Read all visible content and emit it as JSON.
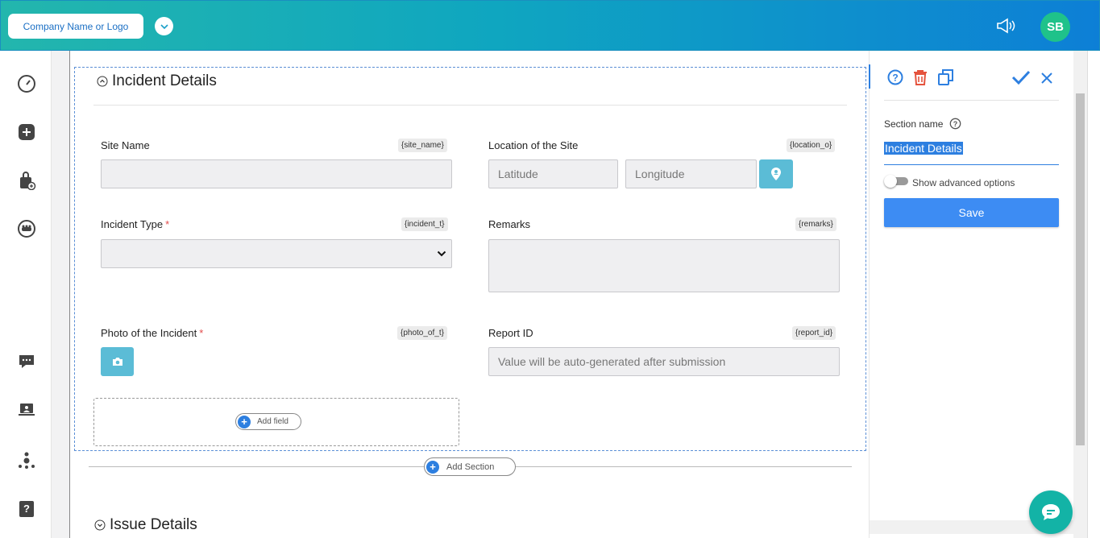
{
  "topbar": {
    "company_label": "Company Name or Logo",
    "avatar_initials": "SB"
  },
  "sidebar": {
    "icons": [
      "dashboard-gauge-icon",
      "add-square-icon",
      "bag-add-icon",
      "users-circle-icon",
      "chat-icon",
      "laptop-user-icon",
      "org-tree-icon",
      "help-book-icon"
    ]
  },
  "section": {
    "title": "Incident Details",
    "fields": {
      "site_name": {
        "label": "Site Name",
        "tag": "{site_name}",
        "value": ""
      },
      "location": {
        "label": "Location of the Site",
        "tag": "{location_o}",
        "lat_placeholder": "Latitude",
        "lng_placeholder": "Longitude"
      },
      "incident_type": {
        "label": "Incident Type",
        "required_mark": "*",
        "tag": "{incident_t}",
        "value": ""
      },
      "remarks": {
        "label": "Remarks",
        "tag": "{remarks}",
        "value": ""
      },
      "photo": {
        "label": "Photo of the Incident",
        "required_mark": "*",
        "tag": "{photo_of_t}"
      },
      "report_id": {
        "label": "Report ID",
        "tag": "{report_id}",
        "placeholder": "Value will be auto-generated after submission"
      }
    },
    "add_field_label": "Add field"
  },
  "add_section_label": "Add Section",
  "next_section": {
    "title": "Issue Details"
  },
  "right_panel": {
    "section_name_label": "Section name",
    "section_name_value": "Incident Details",
    "advanced_toggle_label": "Show advanced options",
    "advanced_toggle_on": false,
    "save_label": "Save"
  },
  "colors": {
    "accent": "#2d7fe0",
    "delete": "#e5533d",
    "teal": "#13b3a6"
  }
}
